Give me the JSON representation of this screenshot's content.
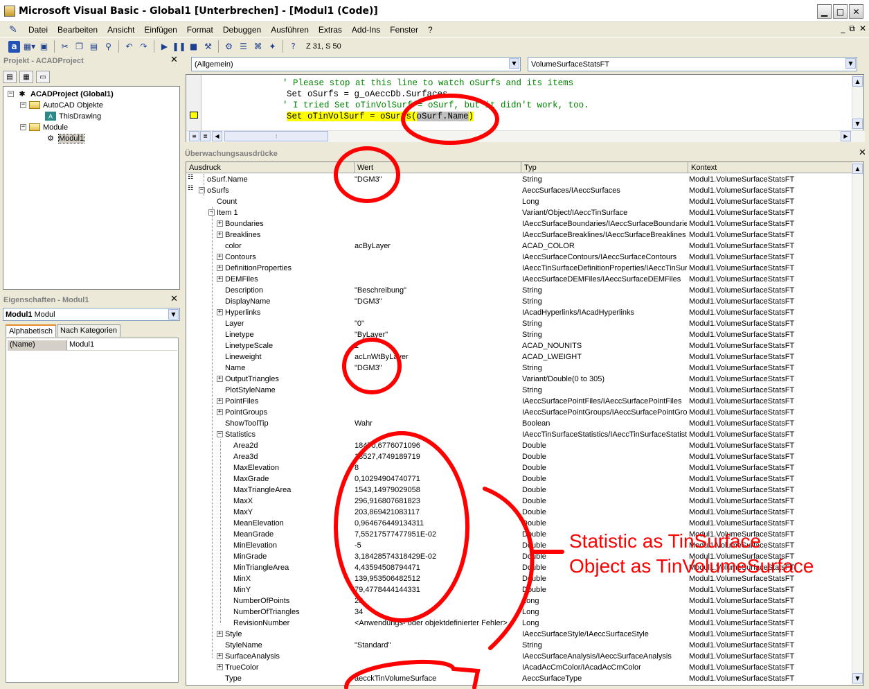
{
  "window": {
    "title": "Microsoft Visual Basic - Global1 [Unterbrechen] - [Modul1 (Code)]",
    "minimize": "▁",
    "maximize": "□",
    "close": "✕"
  },
  "menu": {
    "items": [
      "Datei",
      "Bearbeiten",
      "Ansicht",
      "Einfügen",
      "Format",
      "Debuggen",
      "Ausführen",
      "Extras",
      "Add-Ins",
      "Fenster",
      "?"
    ],
    "mdi": [
      "_",
      "⧉",
      "✕"
    ]
  },
  "toolbar": {
    "position": "Z 31, S 50"
  },
  "project": {
    "title": "Projekt - ACADProject",
    "root": "ACADProject (Global1)",
    "folder1": "AutoCAD Objekte",
    "thisdrawing": "ThisDrawing",
    "folder2": "Module",
    "module": "Modul1"
  },
  "properties": {
    "title": "Eigenschaften - Modul1",
    "combo_bold": "Modul1",
    "combo_rest": "Modul",
    "tab_alpha": "Alphabetisch",
    "tab_cat": "Nach Kategorien",
    "row_name": "(Name)",
    "row_value": "Modul1"
  },
  "code": {
    "object_combo": "(Allgemein)",
    "proc_combo": "VolumeSurfaceStatsFT",
    "line1": "' Please stop at this line to watch oSurfs and its items",
    "line2": "Set oSurfs = g_oAeccDb.Surfaces",
    "line3": "' I tried Set oTinVolSurf = oSurf, but it didn't work, too.",
    "line4_pre": "Set oTinVolSurf = oSurfs(",
    "line4_sel": "oSurf.Name",
    "line4_post": ")"
  },
  "watch": {
    "title": "Überwachungsausdrücke",
    "headers": {
      "expr": "Ausdruck",
      "val": "Wert",
      "type": "Typ",
      "ctx": "Kontext"
    },
    "context": "Modul1.VolumeSurfaceStatsFT",
    "rows": [
      {
        "expr": "oSurf.Name",
        "val": "\"DGM3\"",
        "type": "String"
      },
      {
        "expr": "oSurfs",
        "val": "",
        "type": "AeccSurfaces/IAeccSurfaces"
      },
      {
        "expr": "Count",
        "val": "",
        "type": "Long"
      },
      {
        "expr": "Item 1",
        "val": "",
        "type": "Variant/Object/IAeccTinSurface"
      },
      {
        "expr": "Boundaries",
        "val": "",
        "type": "IAeccSurfaceBoundaries/IAeccSurfaceBoundaries"
      },
      {
        "expr": "Breaklines",
        "val": "",
        "type": "IAeccSurfaceBreaklines/IAeccSurfaceBreaklines"
      },
      {
        "expr": "color",
        "val": "acByLayer",
        "type": "ACAD_COLOR"
      },
      {
        "expr": "Contours",
        "val": "",
        "type": "IAeccSurfaceContours/IAeccSurfaceContours"
      },
      {
        "expr": "DefinitionProperties",
        "val": "",
        "type": "IAeccTinSurfaceDefinitionProperties/IAeccTinSurfaceDefinitionProperties"
      },
      {
        "expr": "DEMFiles",
        "val": "",
        "type": "IAeccSurfaceDEMFiles/IAeccSurfaceDEMFiles"
      },
      {
        "expr": "Description",
        "val": "\"Beschreibung\"",
        "type": "String"
      },
      {
        "expr": "DisplayName",
        "val": "\"DGM3\"",
        "type": "String"
      },
      {
        "expr": "Hyperlinks",
        "val": "",
        "type": "IAcadHyperlinks/IAcadHyperlinks"
      },
      {
        "expr": "Layer",
        "val": "\"0\"",
        "type": "String"
      },
      {
        "expr": "Linetype",
        "val": "\"ByLayer\"",
        "type": "String"
      },
      {
        "expr": "LinetypeScale",
        "val": "1",
        "type": "ACAD_NOUNITS"
      },
      {
        "expr": "Lineweight",
        "val": "acLnWtByLayer",
        "type": "ACAD_LWEIGHT"
      },
      {
        "expr": "Name",
        "val": "\"DGM3\"",
        "type": "String"
      },
      {
        "expr": "OutputTriangles",
        "val": "",
        "type": "Variant/Double(0 to 305)"
      },
      {
        "expr": "PlotStyleName",
        "val": "",
        "type": "String"
      },
      {
        "expr": "PointFiles",
        "val": "",
        "type": "IAeccSurfacePointFiles/IAeccSurfacePointFiles"
      },
      {
        "expr": "PointGroups",
        "val": "",
        "type": "IAeccSurfacePointGroups/IAeccSurfacePointGroups"
      },
      {
        "expr": "ShowToolTip",
        "val": "Wahr",
        "type": "Boolean"
      },
      {
        "expr": "Statistics",
        "val": "",
        "type": "IAeccTinSurfaceStatistics/IAeccTinSurfaceStatistics"
      },
      {
        "expr": "Area2d",
        "val": "18470,6776071096",
        "type": "Double"
      },
      {
        "expr": "Area3d",
        "val": "18527,4749189719",
        "type": "Double"
      },
      {
        "expr": "MaxElevation",
        "val": "8",
        "type": "Double"
      },
      {
        "expr": "MaxGrade",
        "val": "0,10294904740771",
        "type": "Double"
      },
      {
        "expr": "MaxTriangleArea",
        "val": "1543,14979029058",
        "type": "Double"
      },
      {
        "expr": "MaxX",
        "val": "296,916807681823",
        "type": "Double"
      },
      {
        "expr": "MaxY",
        "val": "203,869421083117",
        "type": "Double"
      },
      {
        "expr": "MeanElevation",
        "val": "0,964676449134311",
        "type": "Double"
      },
      {
        "expr": "MeanGrade",
        "val": "7,55217577477951E-02",
        "type": "Double"
      },
      {
        "expr": "MinElevation",
        "val": "-5",
        "type": "Double"
      },
      {
        "expr": "MinGrade",
        "val": "3,18428574318429E-02",
        "type": "Double"
      },
      {
        "expr": "MinTriangleArea",
        "val": "4,43594508794471",
        "type": "Double"
      },
      {
        "expr": "MinX",
        "val": "139,953506482512",
        "type": "Double"
      },
      {
        "expr": "MinY",
        "val": "79,4778444144331",
        "type": "Double"
      },
      {
        "expr": "NumberOfPoints",
        "val": "28",
        "type": "Long"
      },
      {
        "expr": "NumberOfTriangles",
        "val": "34",
        "type": "Long"
      },
      {
        "expr": "RevisionNumber",
        "val": "<Anwendungs- oder objektdefinierter Fehler>",
        "type": "Long"
      },
      {
        "expr": "Style",
        "val": "",
        "type": "IAeccSurfaceStyle/IAeccSurfaceStyle"
      },
      {
        "expr": "StyleName",
        "val": "\"Standard\"",
        "type": "String"
      },
      {
        "expr": "SurfaceAnalysis",
        "val": "",
        "type": "IAeccSurfaceAnalysis/IAeccSurfaceAnalysis"
      },
      {
        "expr": "TrueColor",
        "val": "",
        "type": "IAcadAcCmColor/IAcadAcCmColor"
      },
      {
        "expr": "Type",
        "val": "aecckTinVolumeSurface",
        "type": "AeccSurfaceType"
      }
    ]
  },
  "annotation": {
    "line1": "Statistic as TinSurface",
    "line2": "Object as TinVolumeSurface",
    "color": "#ff0000"
  }
}
